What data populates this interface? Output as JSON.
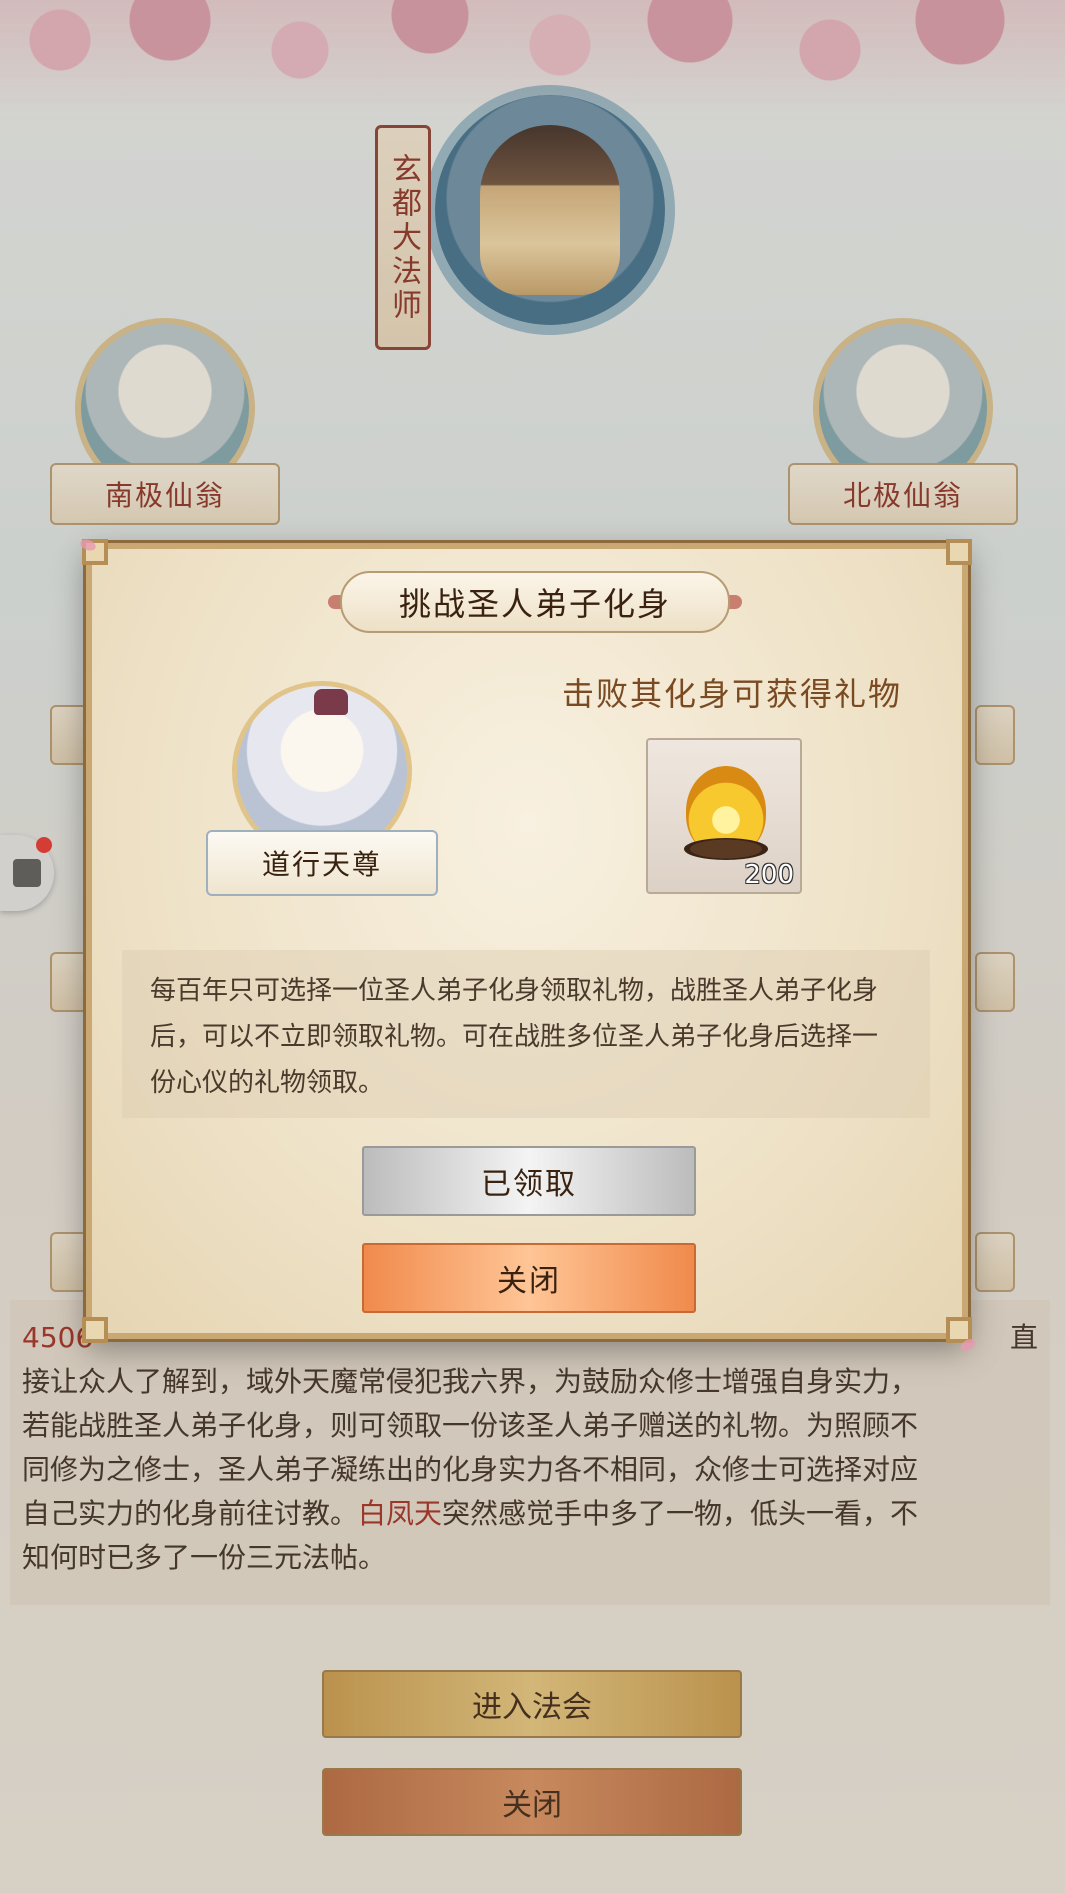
{
  "master": {
    "title": "玄都大法师"
  },
  "elders": {
    "left": "南极仙翁",
    "right": "北极仙翁"
  },
  "story": {
    "line1_prefix": "4506",
    "line1_suffix": "直",
    "line2": "接让众人了解到，域外天魔常侵犯我六界，为鼓励众修士增强自身实力，",
    "line3": "若能战胜圣人弟子化身，则可领取一份该圣人弟子赠送的礼物。为照顾不",
    "line4": "同修为之修士，圣人弟子凝练出的化身实力各不相同，众修士可选择对应",
    "line5_a": "自己实力的化身前往讨教。",
    "line5_name": "白凤天",
    "line5_b": "突然感觉手中多了一物，低头一看，不",
    "line6": "知何时已多了一份三元法帖。"
  },
  "bottom_buttons": {
    "enter": "进入法会",
    "close": "关闭"
  },
  "dialog": {
    "title": "挑战圣人弟子化身",
    "reward_heading": "击败其化身可获得礼物",
    "sage_name": "道行天尊",
    "reward_item": {
      "icon": "golden-flame-icon",
      "quantity": "200"
    },
    "description": "每百年只可选择一位圣人弟子化身领取礼物，战胜圣人弟子化身后，可以不立即领取礼物。可在战胜多位圣人弟子化身后选择一份心仪的礼物领取。",
    "claimed_button": "已领取",
    "close_button": "关闭"
  },
  "colors": {
    "highlight_name": "#a32a1f",
    "close_button": "#f08a4c",
    "claimed_button": "#d8d8d8"
  }
}
